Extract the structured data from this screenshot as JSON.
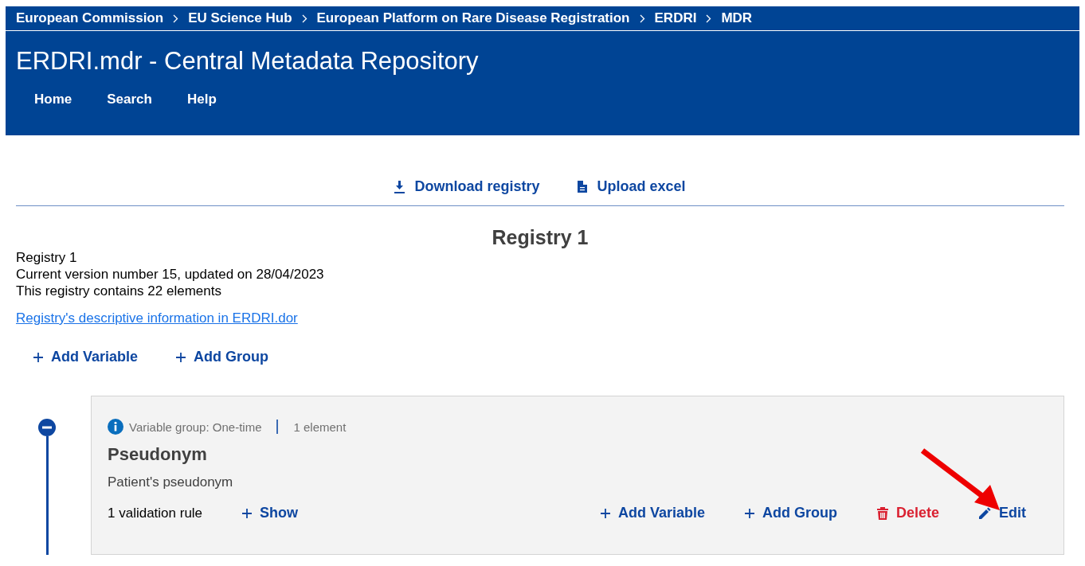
{
  "breadcrumbs": [
    "European Commission",
    "EU Science Hub",
    "European Platform on Rare Disease Registration",
    "ERDRI",
    "MDR"
  ],
  "site_title": "ERDRI.mdr - Central Metadata Repository",
  "nav": [
    "Home",
    "Search",
    "Help"
  ],
  "toolbar": [
    {
      "kind": "download",
      "label": "Download registry"
    },
    {
      "kind": "upload",
      "label": "Upload excel"
    }
  ],
  "registry": {
    "heading": "Registry 1",
    "info": [
      "Registry 1",
      "Current version number 15, updated on 28/04/2023",
      "This registry contains 22 elements"
    ],
    "link": "Registry's descriptive information in ERDRI.dor"
  },
  "actions": [
    {
      "kind": "add",
      "label": "Add Variable"
    },
    {
      "kind": "add",
      "label": "Add Group"
    }
  ],
  "group": {
    "expanded": true,
    "type_label": "Variable group: One-time",
    "count": "1 element",
    "title": "Pseudonym",
    "description": "Patient's pseudonym",
    "rules": "1 validation rule",
    "show": "Show",
    "actions": [
      {
        "kind": "add",
        "label": "Add Variable"
      },
      {
        "kind": "add",
        "label": "Add Group"
      },
      {
        "kind": "delete",
        "label": "Delete"
      },
      {
        "kind": "edit",
        "label": "Edit"
      }
    ]
  }
}
